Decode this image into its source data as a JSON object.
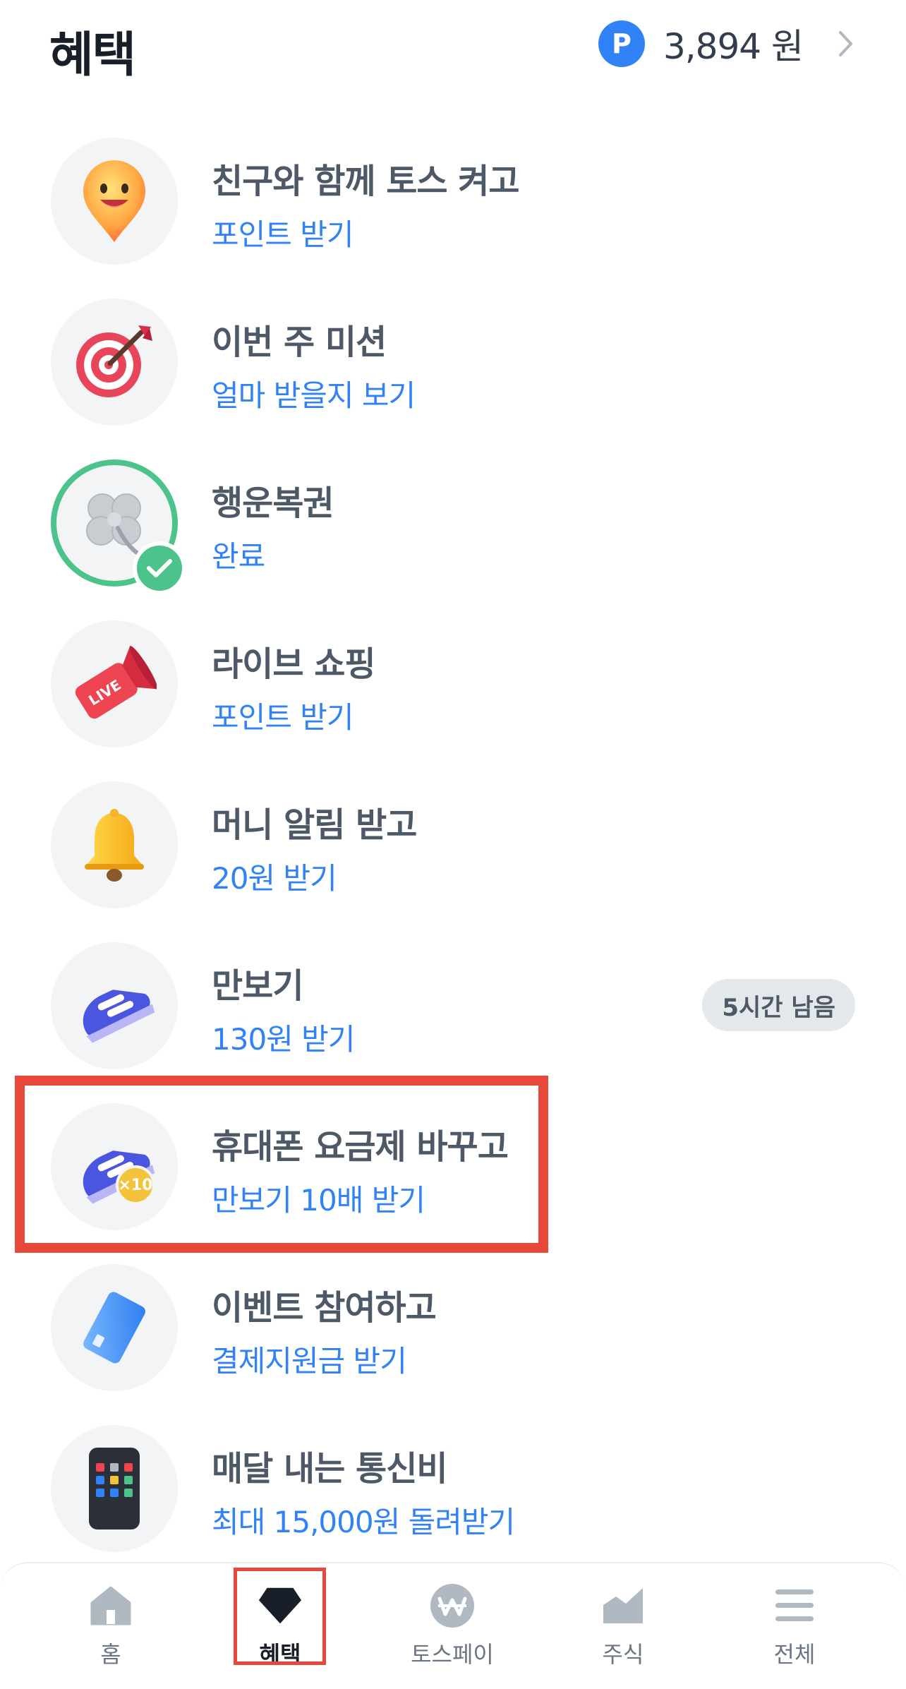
{
  "header": {
    "title": "혜택",
    "points_badge": "P",
    "points_value": "3,894 원"
  },
  "items": [
    {
      "title": "친구와 함께 토스 켜고",
      "subtitle": "포인트 받기",
      "icon": "smiley-pin-icon"
    },
    {
      "title": "이번 주 미션",
      "subtitle": "얼마 받을지 보기",
      "icon": "target-dart-icon"
    },
    {
      "title": "행운복권",
      "subtitle": "완료",
      "icon": "clover-icon",
      "completed": true
    },
    {
      "title": "라이브 쇼핑",
      "subtitle": "포인트 받기",
      "icon": "live-megaphone-icon"
    },
    {
      "title": "머니 알림 받고",
      "subtitle": "20원 받기",
      "icon": "bell-icon"
    },
    {
      "title": "만보기",
      "subtitle": "130원 받기",
      "icon": "sneaker-icon",
      "badge": "5시간 남음"
    },
    {
      "title": "휴대폰 요금제 바꾸고",
      "subtitle": "만보기 10배 받기",
      "icon": "sneaker-x10-icon",
      "icon_badge": "×10"
    },
    {
      "title": "이벤트 참여하고",
      "subtitle": "결제지원금 받기",
      "icon": "card-icon"
    },
    {
      "title": "매달 내는 통신비",
      "subtitle": "최대 15,000원 돌려받기",
      "icon": "phone-icon"
    }
  ],
  "tabbar": {
    "tabs": [
      {
        "label": "홈",
        "icon": "home-icon"
      },
      {
        "label": "혜택",
        "icon": "diamond-icon",
        "active": true
      },
      {
        "label": "토스페이",
        "icon": "won-icon"
      },
      {
        "label": "주식",
        "icon": "chart-icon"
      },
      {
        "label": "전체",
        "icon": "menu-icon"
      }
    ]
  },
  "colors": {
    "accent": "#3182f6",
    "title_text": "#4e5968",
    "highlight": "#e8483a",
    "success": "#4cc38a"
  }
}
